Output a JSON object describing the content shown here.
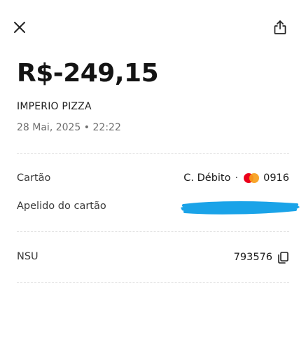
{
  "header": {
    "close_icon": "close-icon",
    "share_icon": "share-icon"
  },
  "transaction": {
    "amount": "R$-249,15",
    "merchant": "IMPERIO PIZZA",
    "datetime": "28 Mai, 2025 • 22:22"
  },
  "details": {
    "card_label": "Cartão",
    "card_type": "C. Débito",
    "card_separator": "·",
    "card_last_digits": "0916",
    "card_brand_icon": "mastercard-logo",
    "nickname_label": "Apelido do cartão",
    "nickname_value_redacted": true,
    "nsu_label": "NSU",
    "nsu_value": "793576",
    "copy_icon": "copy-icon"
  },
  "colors": {
    "redaction": "#1aa3e8",
    "mastercard_red": "#eb001b",
    "mastercard_yellow": "#f79e1b",
    "divider": "#dcdcdc"
  }
}
